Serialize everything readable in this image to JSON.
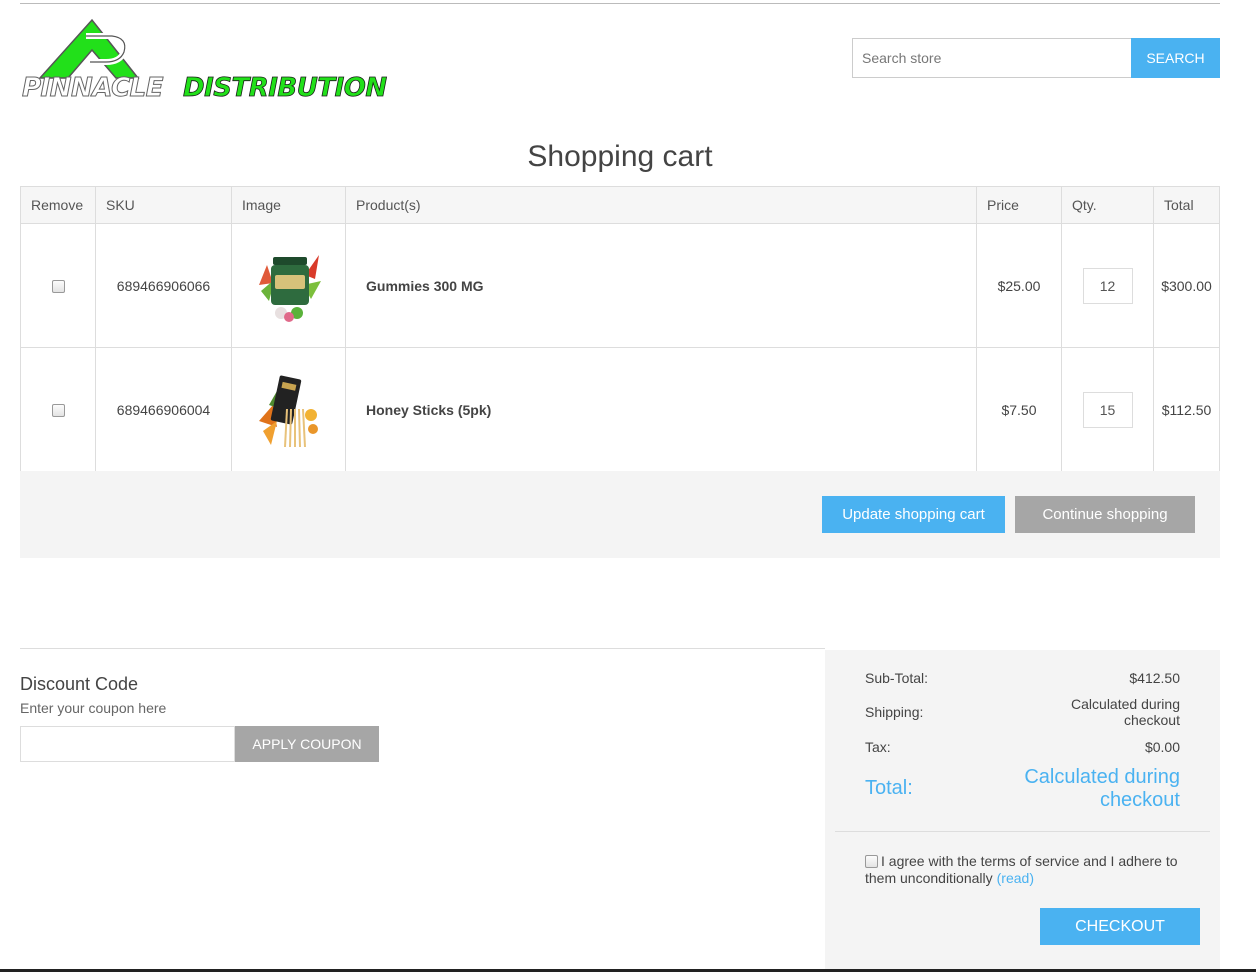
{
  "brand": {
    "logo_text_1": "PINNACLE",
    "logo_text_2": "DISTRIBUTION",
    "green": "#22e01a"
  },
  "search": {
    "placeholder": "Search store",
    "button_label": "SEARCH"
  },
  "page_title": "Shopping cart",
  "cart": {
    "columns": [
      "Remove",
      "SKU",
      "Image",
      "Product(s)",
      "Price",
      "Qty.",
      "Total"
    ],
    "rows": [
      {
        "sku": "689466906066",
        "image_icon": "gummies-jar-image",
        "product": "Gummies 300 MG",
        "price": "$25.00",
        "qty": "12",
        "total": "$300.00"
      },
      {
        "sku": "689466906004",
        "image_icon": "honey-sticks-image",
        "product": "Honey Sticks (5pk)",
        "price": "$7.50",
        "qty": "15",
        "total": "$112.50"
      }
    ],
    "update_label": "Update shopping cart",
    "continue_label": "Continue shopping"
  },
  "discount": {
    "title": "Discount Code",
    "hint": "Enter your coupon here",
    "button_label": "APPLY COUPON"
  },
  "totals": {
    "subtotal_label": "Sub-Total:",
    "subtotal_value": "$412.50",
    "shipping_label": "Shipping:",
    "shipping_value_1": "Calculated during",
    "shipping_value_2": "checkout",
    "tax_label": "Tax:",
    "tax_value": "$0.00",
    "total_label": "Total:",
    "total_value_1": "Calculated during",
    "total_value_2": "checkout",
    "terms_text": "I agree with the terms of service and I adhere to them unconditionally",
    "terms_link": "(read)",
    "checkout_label": "CHECKOUT"
  },
  "colors": {
    "accent": "#4ab2f1",
    "grey_button": "#a6a6a6",
    "panel_bg": "#f4f4f4"
  }
}
